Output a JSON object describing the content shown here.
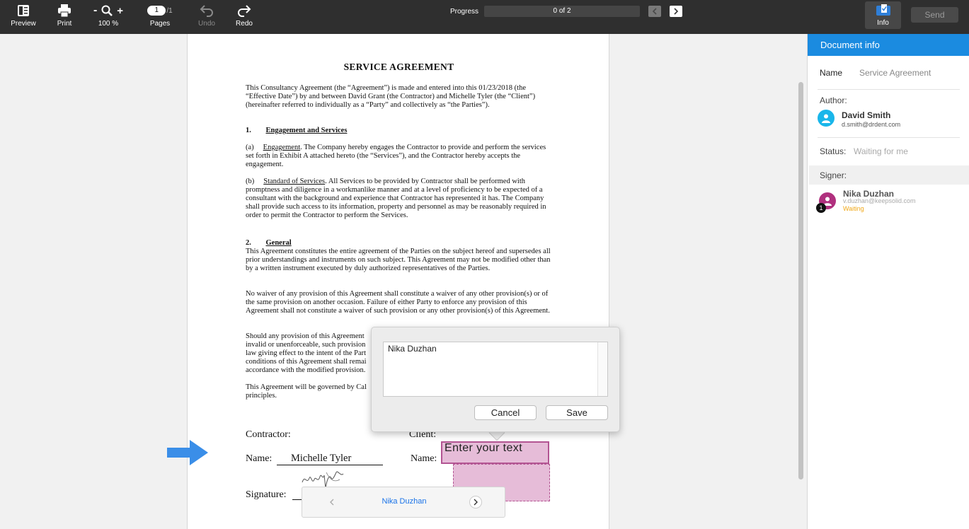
{
  "toolbar": {
    "preview": "Preview",
    "print": "Print",
    "zoom_minus": "-",
    "zoom_plus": "+",
    "zoom": "100 %",
    "page_current": "1",
    "page_total": "/1",
    "pages": "Pages",
    "undo": "Undo",
    "redo": "Redo",
    "progress_label": "Progress",
    "progress_value": "0 of 2",
    "info": "Info",
    "send": "Send"
  },
  "document": {
    "title": "SERVICE  AGREEMENT",
    "intro": "This Consultancy Agreement (the “Agreement”) is made and entered into this  01/23/2018 (the “Effective Date”) by and between David Grant (the Contractor) and Michelle Tyler (the “Client”) (hereinafter referred to individually as a “Party” and collectively as “the Parties”).",
    "s1_num": "1.",
    "s1_title": "Engagement and Services",
    "s1a_num": "(a)",
    "s1a_head": "Engagement",
    "s1a_text": ". The Company hereby engages the Contractor to provide and perform the services set forth in Exhibit A attached hereto (the “Services”), and the Contractor hereby accepts the engagement.",
    "s1b_num": "(b)",
    "s1b_head": "Standard of Services",
    "s1b_text": ". All Services to be provided by Contractor shall be performed with promptness and diligence in a workmanlike manner and at a level of proficiency to be expected of a consultant with the background and experience that Contractor has represented it has. The Company shall provide such access to its information, property and personnel as may be reasonably required in order to permit the Contractor to perform the Services.",
    "s2_num": "2.",
    "s2_title": "General",
    "s2_p1": "This Agreement constitutes the entire agreement of the Parties on the subject hereof and supersedes all prior understandings and instruments on such subject. This Agreement may not be modified other than by a written instrument executed by duly authorized representatives of the Parties.",
    "s2_p2": "No waiver of any provision of this Agreement shall constitute a waiver of any other provision(s) or of the same provision on another occasion. Failure of either Party to enforce any provision of this Agreement shall not constitute a waiver of such provision or any other provision(s) of this Agreement.",
    "s2_p3": "Should any provision of this Agreement\ninvalid or unenforceable, such provision\nlaw giving effect to the intent of the Part\nconditions of this Agreement shall remai\naccordance with the modified provision.",
    "s2_p4": "This Agreement will be governed by Cal\nprinciples.",
    "contractor": "Contractor:",
    "client": "Client:",
    "name_left": "Name:",
    "name_value": "Michelle Tyler",
    "name_right": "Name:",
    "signature": "Signature:"
  },
  "field": {
    "placeholder_text": "Enter your text"
  },
  "popover": {
    "text": "Nika Duzhan",
    "cancel": "Cancel",
    "save": "Save"
  },
  "pager": {
    "name": "Nika Duzhan"
  },
  "panel": {
    "header": "Document info",
    "name_label": "Name",
    "name_value": "Service Agreement",
    "author_label": "Author:",
    "author_name": "David Smith",
    "author_email": "d.smith@drdent.com",
    "status_label": "Status:",
    "status_value": "Waiting for me",
    "signer_label": "Signer:",
    "signer_name": "Nika Duzhan",
    "signer_email": "v.duzhan@keepsolid.com",
    "signer_status": "Waiting",
    "signer_order": "1"
  },
  "colors": {
    "accent": "#1b8be0",
    "field_fill": "#e6bcd8",
    "field_border": "#b35593",
    "waiting": "#f0a818"
  }
}
